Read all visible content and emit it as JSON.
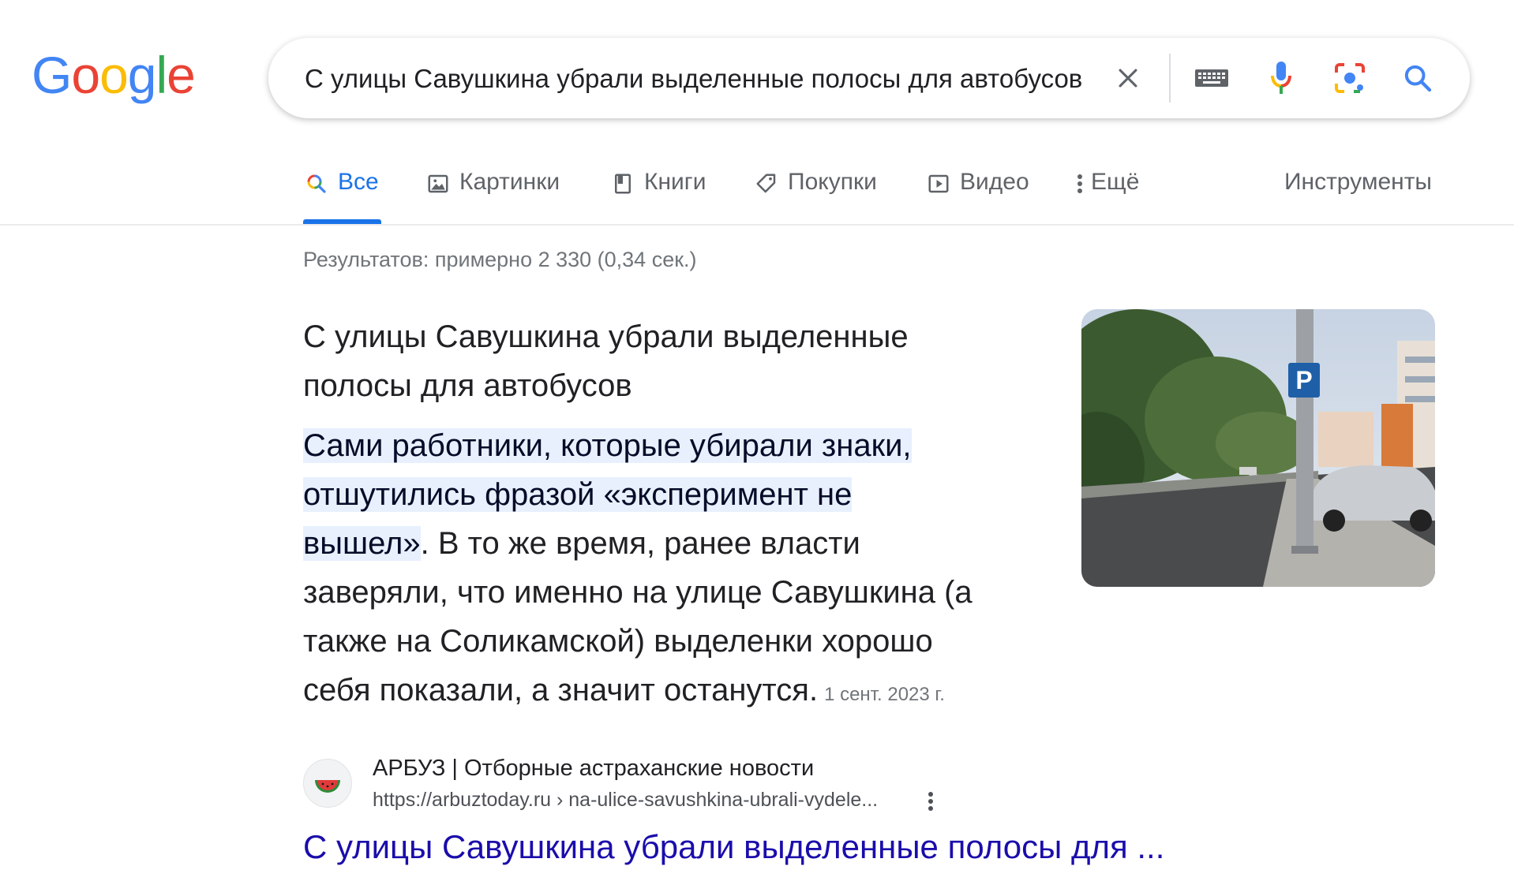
{
  "logo": {
    "letters": [
      "G",
      "o",
      "o",
      "g",
      "l",
      "e"
    ],
    "colors": [
      "#4285F4",
      "#EA4335",
      "#FBBC05",
      "#4285F4",
      "#34A853",
      "#EA4335"
    ]
  },
  "search": {
    "query": "С улицы Савушкина убрали выделенные полосы для автобусов",
    "icons": [
      "close-icon",
      "keyboard-icon",
      "microphone-icon",
      "lens-icon",
      "search-icon"
    ]
  },
  "tabs": [
    {
      "label": "Все",
      "icon": "search-icon",
      "active": true
    },
    {
      "label": "Картинки",
      "icon": "image-icon",
      "active": false
    },
    {
      "label": "Книги",
      "icon": "book-icon",
      "active": false
    },
    {
      "label": "Покупки",
      "icon": "tag-icon",
      "active": false
    },
    {
      "label": "Видео",
      "icon": "play-icon",
      "active": false
    },
    {
      "label": "Ещё",
      "icon": "more-vert-icon",
      "active": false
    }
  ],
  "tools_label": "Инструменты",
  "result_stats": "Результатов: примерно 2 330 (0,34 сек.)",
  "featured_snippet": {
    "title_line1": "С улицы Савушкина убрали выделенные",
    "title_line2": "полосы для автобусов",
    "highlight_line1": "Сами работники, которые убирали знаки,",
    "highlight_line2": "отшутились фразой «эксперимент не",
    "highlight_line3": "вышел»",
    "body_rest1": ". В то же время, ранее власти",
    "body_line4": "заверяли, что именно на улице Савушкина (а",
    "body_line5": "также на Соликамской) выделенки хорошо",
    "body_line6": "себя показали, а значит останутся.",
    "date": "1 сент. 2023 г.",
    "image": "street-photo-parking-sign"
  },
  "source": {
    "site_name": "АРБУЗ | Отборные астраханские новости",
    "url": "https://arbuztoday.ru › na-ulice-savushkina-ubrali-vydele...",
    "favicon": "watermelon-icon",
    "title": "С улицы Савушкина убрали выделенные полосы для ..."
  },
  "colors": {
    "accent": "#1a73e8",
    "link": "#1a0dab",
    "highlight_bg": "#e8f0fe",
    "muted": "#70757a"
  }
}
